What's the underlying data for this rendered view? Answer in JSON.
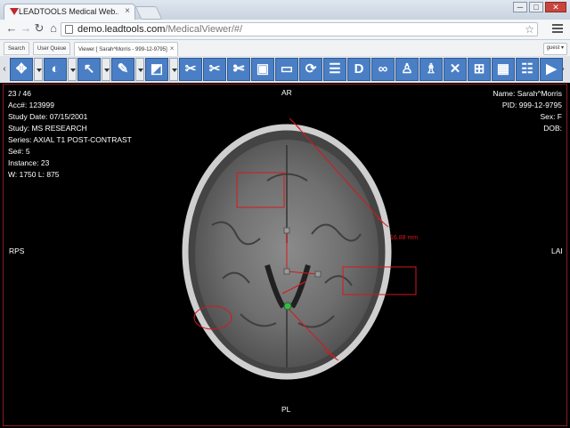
{
  "browser": {
    "tab_title": "LEADTOOLS Medical Web...",
    "url_host": "demo.leadtools.com",
    "url_path": "/MedicalViewer/#/",
    "min_label": "─",
    "max_label": "□",
    "close_label": "✕",
    "tab_close": "×"
  },
  "app": {
    "tabs": [
      {
        "label": "Search"
      },
      {
        "label": "User Queue"
      },
      {
        "label": "Viewer [ Sarah^Morris - 999-12-9795]",
        "active": true
      }
    ],
    "tab_close": "×",
    "user": "guest ▾"
  },
  "toolbar": {
    "buttons": [
      {
        "icon": "move-arrows-icon",
        "glyph": "✥"
      },
      {
        "icon": "window-level-icon",
        "glyph": "◐"
      },
      {
        "icon": "pointer-arrow-icon",
        "glyph": "↖"
      },
      {
        "icon": "annotation-pen-icon",
        "glyph": "✎"
      },
      {
        "icon": "shutter-icon",
        "glyph": "◩"
      },
      {
        "icon": "scissors-crop-icon",
        "glyph": "✂"
      },
      {
        "icon": "cut-icon",
        "glyph": "✂"
      },
      {
        "icon": "cut-alt-icon",
        "glyph": "✄"
      },
      {
        "icon": "save-icon",
        "glyph": "▣"
      },
      {
        "icon": "open-folder-icon",
        "glyph": "▭"
      },
      {
        "icon": "refresh-icon",
        "glyph": "⟳"
      },
      {
        "icon": "report-icon",
        "glyph": "☰"
      },
      {
        "icon": "d-letter-icon",
        "glyph": "D"
      },
      {
        "icon": "link-icon",
        "glyph": "∞"
      },
      {
        "icon": "person-icon",
        "glyph": "♙"
      },
      {
        "icon": "person-target-icon",
        "glyph": "♗"
      },
      {
        "icon": "cross-tool-icon",
        "glyph": "✕"
      },
      {
        "icon": "layout-2x2-icon",
        "glyph": "⊞"
      },
      {
        "icon": "layout-3x3-icon",
        "glyph": "▦"
      },
      {
        "icon": "series-list-icon",
        "glyph": "☷"
      },
      {
        "icon": "video-camera-icon",
        "glyph": "▶"
      }
    ],
    "scroll_left": "‹",
    "scroll_right": "›"
  },
  "viewer": {
    "top_left": [
      "23 / 46",
      "Acc#: 123999",
      "Study Date: 07/15/2001",
      "Study: MS RESEARCH",
      "Series: AXIAL T1 POST-CONTRAST",
      "Se#: 5",
      "Instance: 23",
      "W: 1750 L: 875"
    ],
    "top_right": [
      "Name: Sarah^Morris",
      "PID: 999-12-9795",
      "Sex: F",
      "DOB:"
    ],
    "orient_top": "AR",
    "orient_bottom": "PL",
    "orient_left": "RPS",
    "orient_right": "LAI",
    "measurement": "16.88 mm",
    "annotation_color": "#d6181c"
  }
}
